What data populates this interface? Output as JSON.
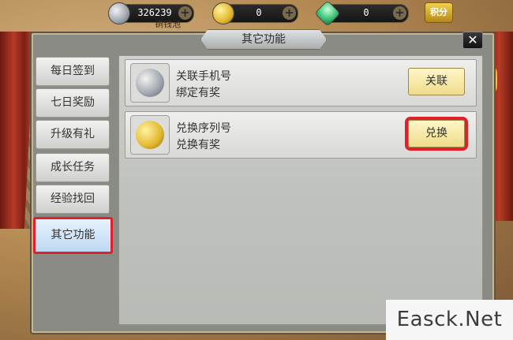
{
  "top_bar": {
    "resources": [
      {
        "icon": "silver-coin-icon",
        "value": "326239"
      },
      {
        "icon": "gold-coin-icon",
        "value": "0"
      },
      {
        "icon": "jade-gem-icon",
        "value": "0"
      }
    ],
    "add_symbol": "+",
    "score_button": "积分",
    "peek_text": "铜钱池"
  },
  "window": {
    "title": "其它功能",
    "close_symbol": "✕"
  },
  "tabs": [
    {
      "label": "每日签到"
    },
    {
      "label": "七日奖励"
    },
    {
      "label": "升级有礼"
    },
    {
      "label": "成长任务"
    },
    {
      "label": "经验找回"
    },
    {
      "label": "其它功能",
      "active": true
    }
  ],
  "rows": [
    {
      "icon": "silver-coin-icon",
      "title": "关联手机号",
      "subtitle": "绑定有奖",
      "action": "关联"
    },
    {
      "icon": "gold-coin-icon",
      "title": "兑换序列号",
      "subtitle": "兑换有奖",
      "action": "兑换",
      "highlighted": true
    }
  ],
  "watermark": "Easck.Net",
  "colors": {
    "highlight": "#e0202a",
    "active_tab": "#bfd8f2",
    "action_button": "#eedc8a"
  }
}
